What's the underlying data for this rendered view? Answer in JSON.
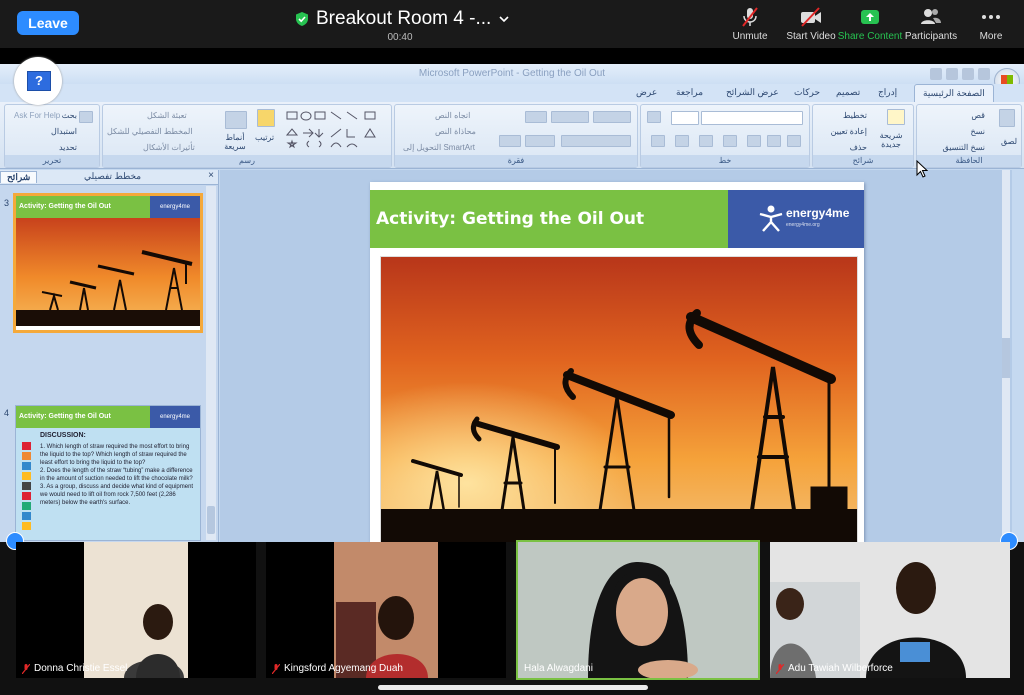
{
  "zoom": {
    "leave_label": "Leave",
    "room_title": "Breakout Room 4 -...",
    "timer": "00:40",
    "tools": [
      {
        "label": "Unmute",
        "icon": "mic-muted-icon"
      },
      {
        "label": "Start Video",
        "icon": "video-off-icon"
      },
      {
        "label": "Share Content",
        "icon": "share-icon"
      },
      {
        "label": "Participants",
        "icon": "participants-icon"
      },
      {
        "label": "More",
        "icon": "more-dots-icon"
      }
    ]
  },
  "ppt": {
    "window_title": "Microsoft PowerPoint - Getting the Oil Out",
    "tabs": [
      "الصفحة الرئيسية",
      "إدراج",
      "تصميم",
      "حركات",
      "عرض الشرائح",
      "مراجعة",
      "عرض"
    ],
    "ribbon": {
      "groups": [
        "الحافظة",
        "شرائح",
        "خط",
        "فقرة",
        "رسم",
        "تحرير"
      ],
      "clipboard_items": [
        "قص",
        "نسخ",
        "نسخ التنسيق",
        "لصق"
      ],
      "slides_items": [
        "تخطيط",
        "إعادة تعيين",
        "حذف",
        "شريحة جديدة"
      ],
      "paragraph_items": [
        "اتجاه النص",
        "محاذاة النص",
        "التحويل إلى SmartArt"
      ],
      "drawing_items": [
        "تعبئة الشكل",
        "المخطط التفصيلي للشكل",
        "تأثيرات الأشكال",
        "أنماط سريعة",
        "ترتيب"
      ],
      "editing_items": [
        "بحث",
        "استبدال",
        "تحديد"
      ],
      "ask_help": "Ask For Help"
    },
    "pane": {
      "tab_slides": "شرائح",
      "tab_outline": "مخطط تفصيلي",
      "close": "×",
      "thumbs": [
        {
          "number": "3",
          "title": "Activity: Getting the Oil Out",
          "brand": "energy4me"
        },
        {
          "number": "4",
          "title": "Activity: Getting the Oil Out",
          "brand": "energy4me",
          "heading": "DISCUSSION:",
          "items": [
            "1.  Which length of straw required the most effort to bring the liquid to the top? Which length of straw required the least effort to bring the liquid to the top?",
            "2.  Does the length of the straw “tubing” make a difference in the amount of suction needed to lift the chocolate milk?",
            "3.  As a group, discuss and decide what kind of equipment we would need to lift oil from rock 7,500 feet (2,286 meters) below the earth's surface."
          ]
        }
      ]
    },
    "slide": {
      "title": "Activity: Getting the Oil Out",
      "brand": "energy4me",
      "brand_url": "energy4me.org"
    }
  },
  "participants": [
    {
      "name": "Donna Christie Essel",
      "muted": true
    },
    {
      "name": "Kingsford Agyemang Duah",
      "muted": true
    },
    {
      "name": "Hala Alwagdani",
      "muted": false
    },
    {
      "name": "Adu Tawiah Wilberforce",
      "muted": true
    }
  ],
  "colors": {
    "zoom_blue": "#2d8cff",
    "slide_green": "#7ac143",
    "slide_blue": "#3b5aa8",
    "share_green": "#27c251"
  }
}
